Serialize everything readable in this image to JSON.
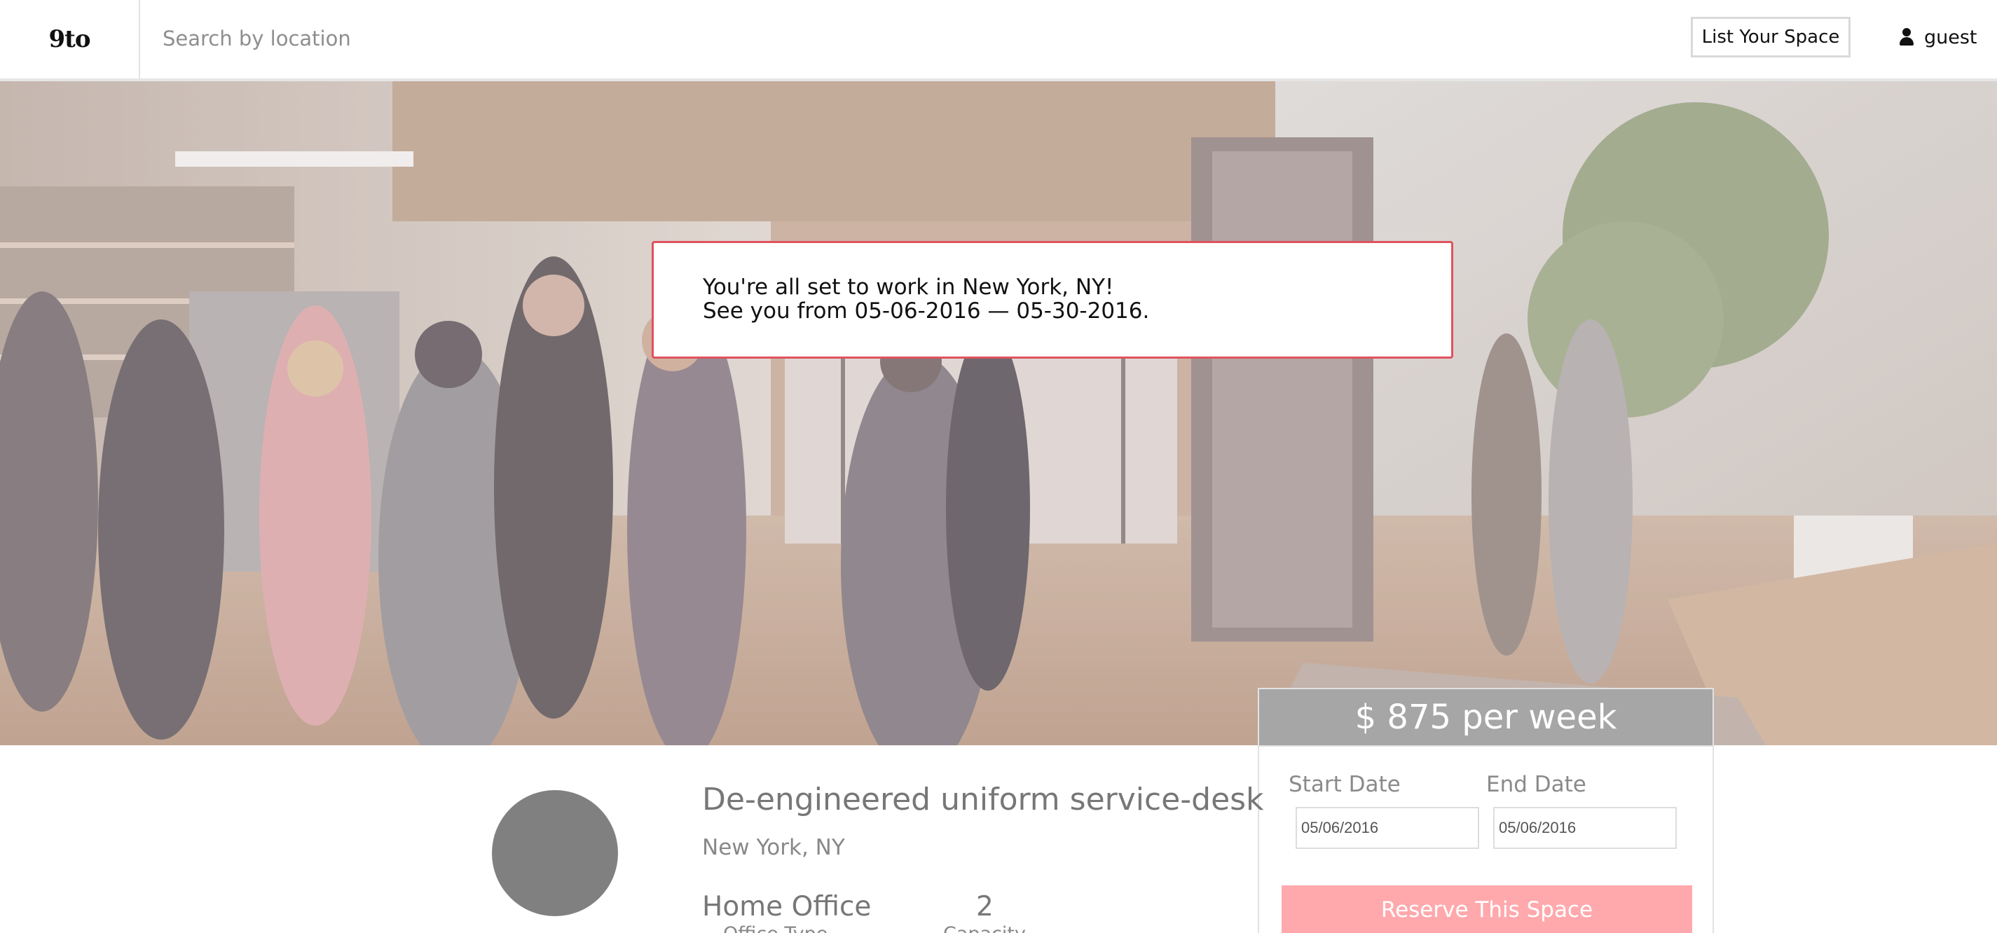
{
  "header": {
    "logo_text": "9to",
    "search_placeholder": "Search by location",
    "list_space_label": "List Your Space",
    "user_label": "guest",
    "user_icon": "user-icon"
  },
  "notice": {
    "line1": "You're all set to work in New York, NY!",
    "line2": "See you from 05-06-2016 — 05-30-2016."
  },
  "booking": {
    "price": "$ 875 per week",
    "start_label": "Start Date",
    "end_label": "End Date",
    "start_value": "05/06/2016",
    "end_value": "05/06/2016",
    "reserve_label": "Reserve This Space"
  },
  "listing": {
    "title": "De-engineered uniform service-desk",
    "location": "New York, NY",
    "office_type_value": "Home Office",
    "office_type_label": "Office Type",
    "capacity_value": "2",
    "capacity_label": "Capacity"
  },
  "colors": {
    "accent": "#e0525e",
    "reserve_bg": "#ffa9ad",
    "price_bar": "#a6a6a6",
    "avatar": "#808080"
  }
}
